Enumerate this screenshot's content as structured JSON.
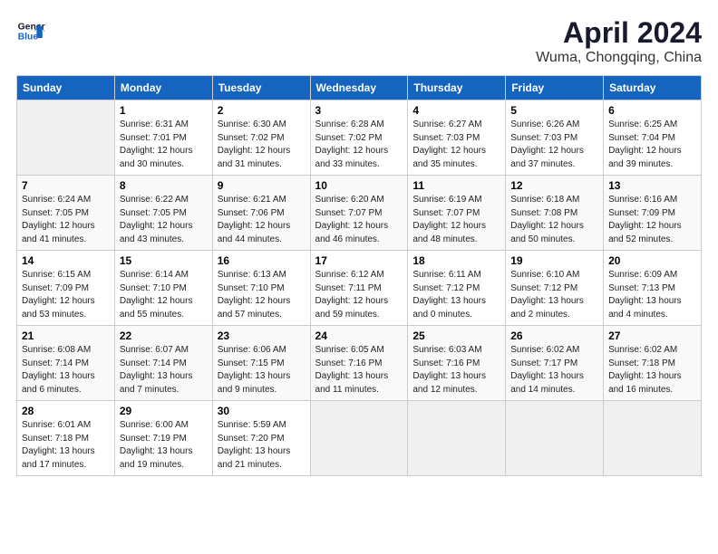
{
  "header": {
    "logo": "General Blue",
    "title": "April 2024",
    "subtitle": "Wuma, Chongqing, China"
  },
  "days_of_week": [
    "Sunday",
    "Monday",
    "Tuesday",
    "Wednesday",
    "Thursday",
    "Friday",
    "Saturday"
  ],
  "weeks": [
    [
      {
        "day": "",
        "info": ""
      },
      {
        "day": "1",
        "info": "Sunrise: 6:31 AM\nSunset: 7:01 PM\nDaylight: 12 hours\nand 30 minutes."
      },
      {
        "day": "2",
        "info": "Sunrise: 6:30 AM\nSunset: 7:02 PM\nDaylight: 12 hours\nand 31 minutes."
      },
      {
        "day": "3",
        "info": "Sunrise: 6:28 AM\nSunset: 7:02 PM\nDaylight: 12 hours\nand 33 minutes."
      },
      {
        "day": "4",
        "info": "Sunrise: 6:27 AM\nSunset: 7:03 PM\nDaylight: 12 hours\nand 35 minutes."
      },
      {
        "day": "5",
        "info": "Sunrise: 6:26 AM\nSunset: 7:03 PM\nDaylight: 12 hours\nand 37 minutes."
      },
      {
        "day": "6",
        "info": "Sunrise: 6:25 AM\nSunset: 7:04 PM\nDaylight: 12 hours\nand 39 minutes."
      }
    ],
    [
      {
        "day": "7",
        "info": "Sunrise: 6:24 AM\nSunset: 7:05 PM\nDaylight: 12 hours\nand 41 minutes."
      },
      {
        "day": "8",
        "info": "Sunrise: 6:22 AM\nSunset: 7:05 PM\nDaylight: 12 hours\nand 43 minutes."
      },
      {
        "day": "9",
        "info": "Sunrise: 6:21 AM\nSunset: 7:06 PM\nDaylight: 12 hours\nand 44 minutes."
      },
      {
        "day": "10",
        "info": "Sunrise: 6:20 AM\nSunset: 7:07 PM\nDaylight: 12 hours\nand 46 minutes."
      },
      {
        "day": "11",
        "info": "Sunrise: 6:19 AM\nSunset: 7:07 PM\nDaylight: 12 hours\nand 48 minutes."
      },
      {
        "day": "12",
        "info": "Sunrise: 6:18 AM\nSunset: 7:08 PM\nDaylight: 12 hours\nand 50 minutes."
      },
      {
        "day": "13",
        "info": "Sunrise: 6:16 AM\nSunset: 7:09 PM\nDaylight: 12 hours\nand 52 minutes."
      }
    ],
    [
      {
        "day": "14",
        "info": "Sunrise: 6:15 AM\nSunset: 7:09 PM\nDaylight: 12 hours\nand 53 minutes."
      },
      {
        "day": "15",
        "info": "Sunrise: 6:14 AM\nSunset: 7:10 PM\nDaylight: 12 hours\nand 55 minutes."
      },
      {
        "day": "16",
        "info": "Sunrise: 6:13 AM\nSunset: 7:10 PM\nDaylight: 12 hours\nand 57 minutes."
      },
      {
        "day": "17",
        "info": "Sunrise: 6:12 AM\nSunset: 7:11 PM\nDaylight: 12 hours\nand 59 minutes."
      },
      {
        "day": "18",
        "info": "Sunrise: 6:11 AM\nSunset: 7:12 PM\nDaylight: 13 hours\nand 0 minutes."
      },
      {
        "day": "19",
        "info": "Sunrise: 6:10 AM\nSunset: 7:12 PM\nDaylight: 13 hours\nand 2 minutes."
      },
      {
        "day": "20",
        "info": "Sunrise: 6:09 AM\nSunset: 7:13 PM\nDaylight: 13 hours\nand 4 minutes."
      }
    ],
    [
      {
        "day": "21",
        "info": "Sunrise: 6:08 AM\nSunset: 7:14 PM\nDaylight: 13 hours\nand 6 minutes."
      },
      {
        "day": "22",
        "info": "Sunrise: 6:07 AM\nSunset: 7:14 PM\nDaylight: 13 hours\nand 7 minutes."
      },
      {
        "day": "23",
        "info": "Sunrise: 6:06 AM\nSunset: 7:15 PM\nDaylight: 13 hours\nand 9 minutes."
      },
      {
        "day": "24",
        "info": "Sunrise: 6:05 AM\nSunset: 7:16 PM\nDaylight: 13 hours\nand 11 minutes."
      },
      {
        "day": "25",
        "info": "Sunrise: 6:03 AM\nSunset: 7:16 PM\nDaylight: 13 hours\nand 12 minutes."
      },
      {
        "day": "26",
        "info": "Sunrise: 6:02 AM\nSunset: 7:17 PM\nDaylight: 13 hours\nand 14 minutes."
      },
      {
        "day": "27",
        "info": "Sunrise: 6:02 AM\nSunset: 7:18 PM\nDaylight: 13 hours\nand 16 minutes."
      }
    ],
    [
      {
        "day": "28",
        "info": "Sunrise: 6:01 AM\nSunset: 7:18 PM\nDaylight: 13 hours\nand 17 minutes."
      },
      {
        "day": "29",
        "info": "Sunrise: 6:00 AM\nSunset: 7:19 PM\nDaylight: 13 hours\nand 19 minutes."
      },
      {
        "day": "30",
        "info": "Sunrise: 5:59 AM\nSunset: 7:20 PM\nDaylight: 13 hours\nand 21 minutes."
      },
      {
        "day": "",
        "info": ""
      },
      {
        "day": "",
        "info": ""
      },
      {
        "day": "",
        "info": ""
      },
      {
        "day": "",
        "info": ""
      }
    ]
  ]
}
